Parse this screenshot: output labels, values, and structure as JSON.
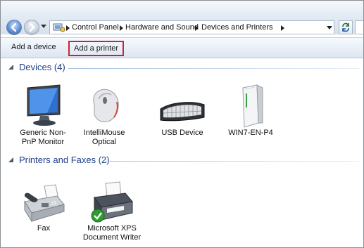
{
  "breadcrumb": {
    "items": [
      "Control Panel",
      "Hardware and Sound",
      "Devices and Printers"
    ]
  },
  "toolbar": {
    "add_device": "Add a device",
    "add_printer": "Add a printer"
  },
  "groups": {
    "devices": {
      "title": "Devices (4)",
      "items": [
        {
          "label": "Generic Non-PnP Monitor",
          "icon": "monitor-icon"
        },
        {
          "label": "IntelliMouse Optical",
          "icon": "mouse-icon"
        },
        {
          "label": "USB Device",
          "icon": "keyboard-icon"
        },
        {
          "label": "WIN7-EN-P4",
          "icon": "computer-tower-icon"
        }
      ]
    },
    "printers": {
      "title": "Printers and Faxes (2)",
      "items": [
        {
          "label": "Fax",
          "icon": "fax-icon"
        },
        {
          "label": "Microsoft XPS Document Writer",
          "icon": "printer-icon",
          "default": true
        }
      ]
    }
  },
  "colors": {
    "group_title": "#1e3f8c",
    "highlight_box": "#d1202f",
    "default_check": "#2d9b2f"
  }
}
